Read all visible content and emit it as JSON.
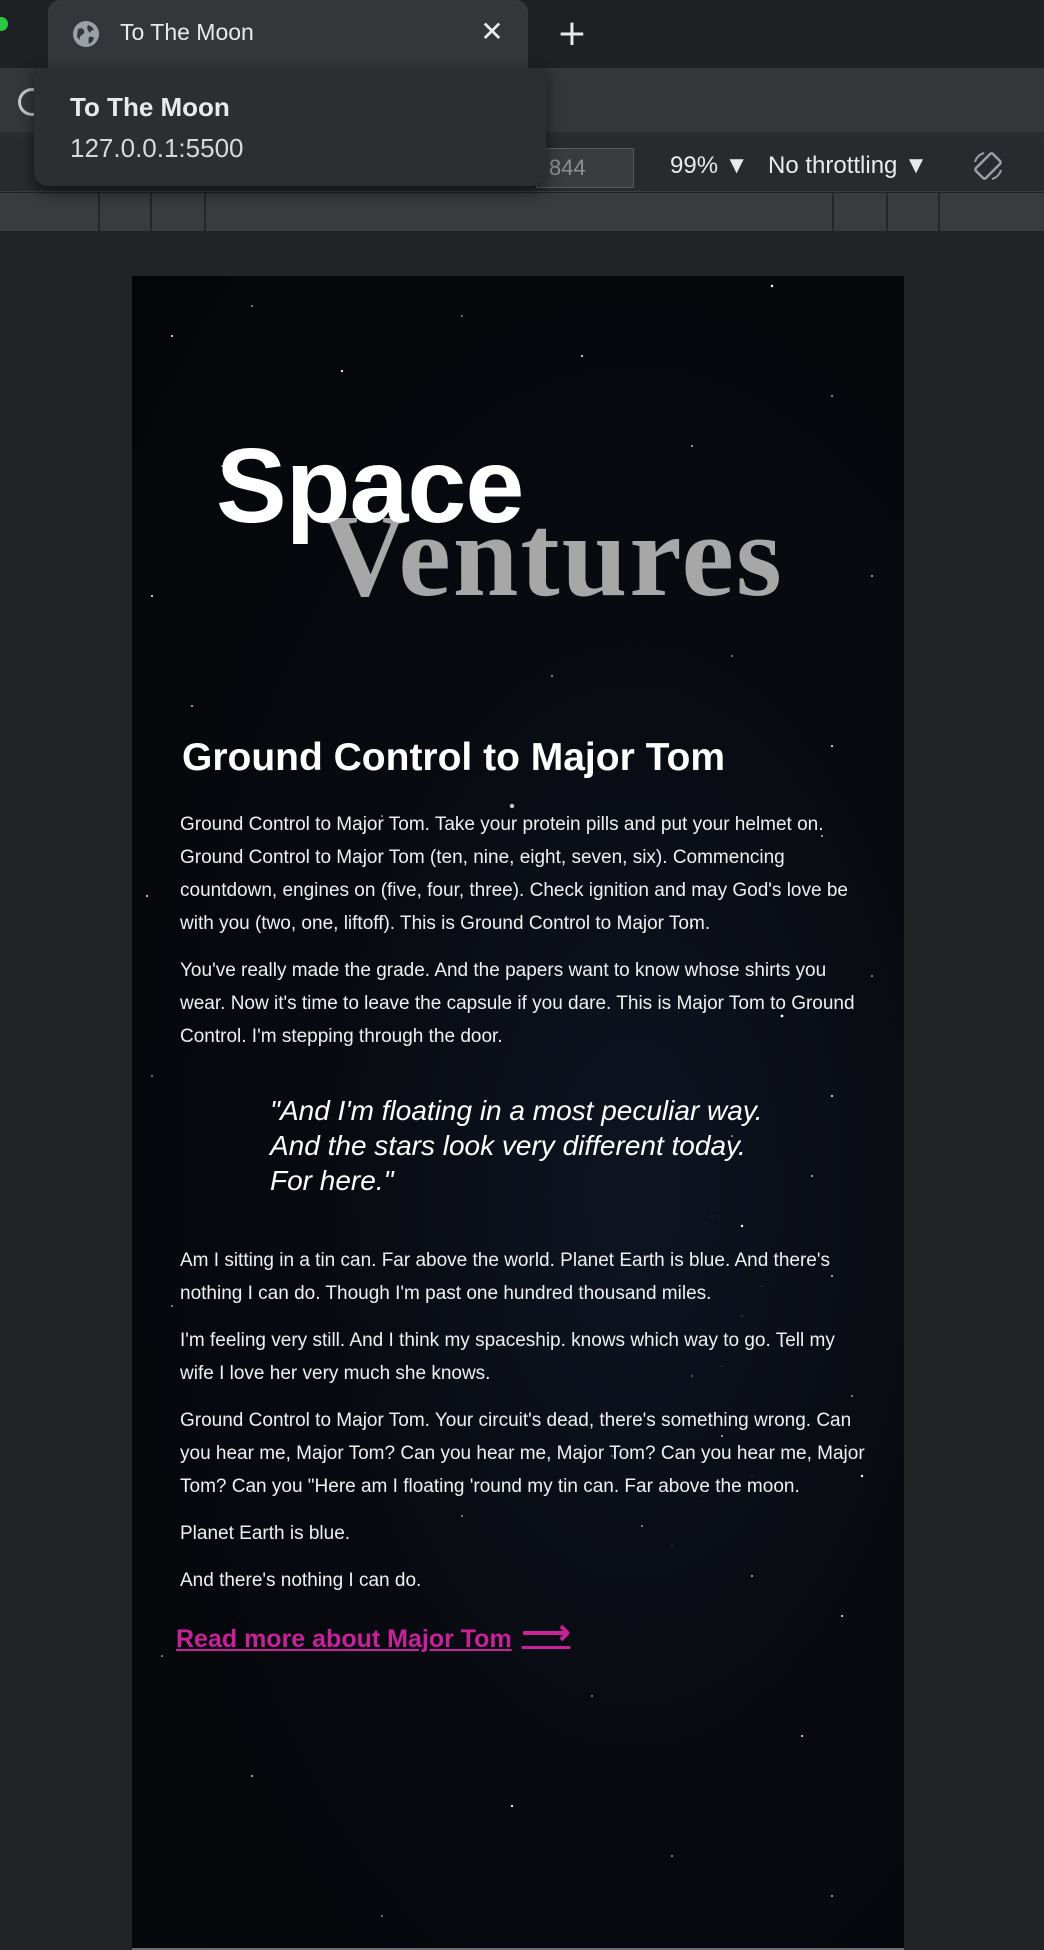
{
  "browser": {
    "tab_title": "To The Moon",
    "close_glyph": "✕",
    "new_tab_glyph": "+",
    "popup": {
      "title": "To The Moon",
      "url": "127.0.0.1:5500"
    }
  },
  "devtools": {
    "height_value": "844",
    "zoom": "99% ▼",
    "throttling": "No throttling ▼"
  },
  "page": {
    "logo": {
      "part1": "Space",
      "part2": "Ventures"
    },
    "heading": "Ground Control to Major Tom",
    "paragraphs": {
      "p1": "Ground Control to Major Tom. Take your protein pills and put your helmet on. Ground Control to Major Tom (ten, nine, eight, seven, six). Commencing countdown, engines on (five, four, three). Check ignition and may God's love be with you (two, one, liftoff). This is Ground Control to Major Tom.",
      "p2": "You've really made the grade. And the papers want to know whose shirts you wear. Now it's time to leave the capsule if you dare. This is Major Tom to Ground Control. I'm stepping through the door.",
      "p3": "Am I sitting in a tin can. Far above the world. Planet Earth is blue. And there's nothing I can do. Though I'm past one hundred thousand miles.",
      "p4": "I'm feeling very still. And I think my spaceship. knows which way to go. Tell my wife I love her very much she knows.",
      "p5": "Ground Control to Major Tom. Your circuit's dead, there's something wrong. Can you hear me, Major Tom? Can you hear me, Major Tom? Can you hear me, Major Tom? Can you \"Here am I floating 'round my tin can. Far above the moon.",
      "p6": "Planet Earth is blue.",
      "p7": "And there's nothing I can do."
    },
    "quote": {
      "line1": "\"And I'm floating in a most peculiar way.",
      "line2": "And the stars look very different today.",
      "line3": "For here.\""
    },
    "read_more": {
      "label": "Read more about Major Tom",
      "arrow": "⟶"
    },
    "colors": {
      "accent": "#c8229a",
      "logo_secondary": "#a7a7a7",
      "background": "#050608"
    }
  }
}
